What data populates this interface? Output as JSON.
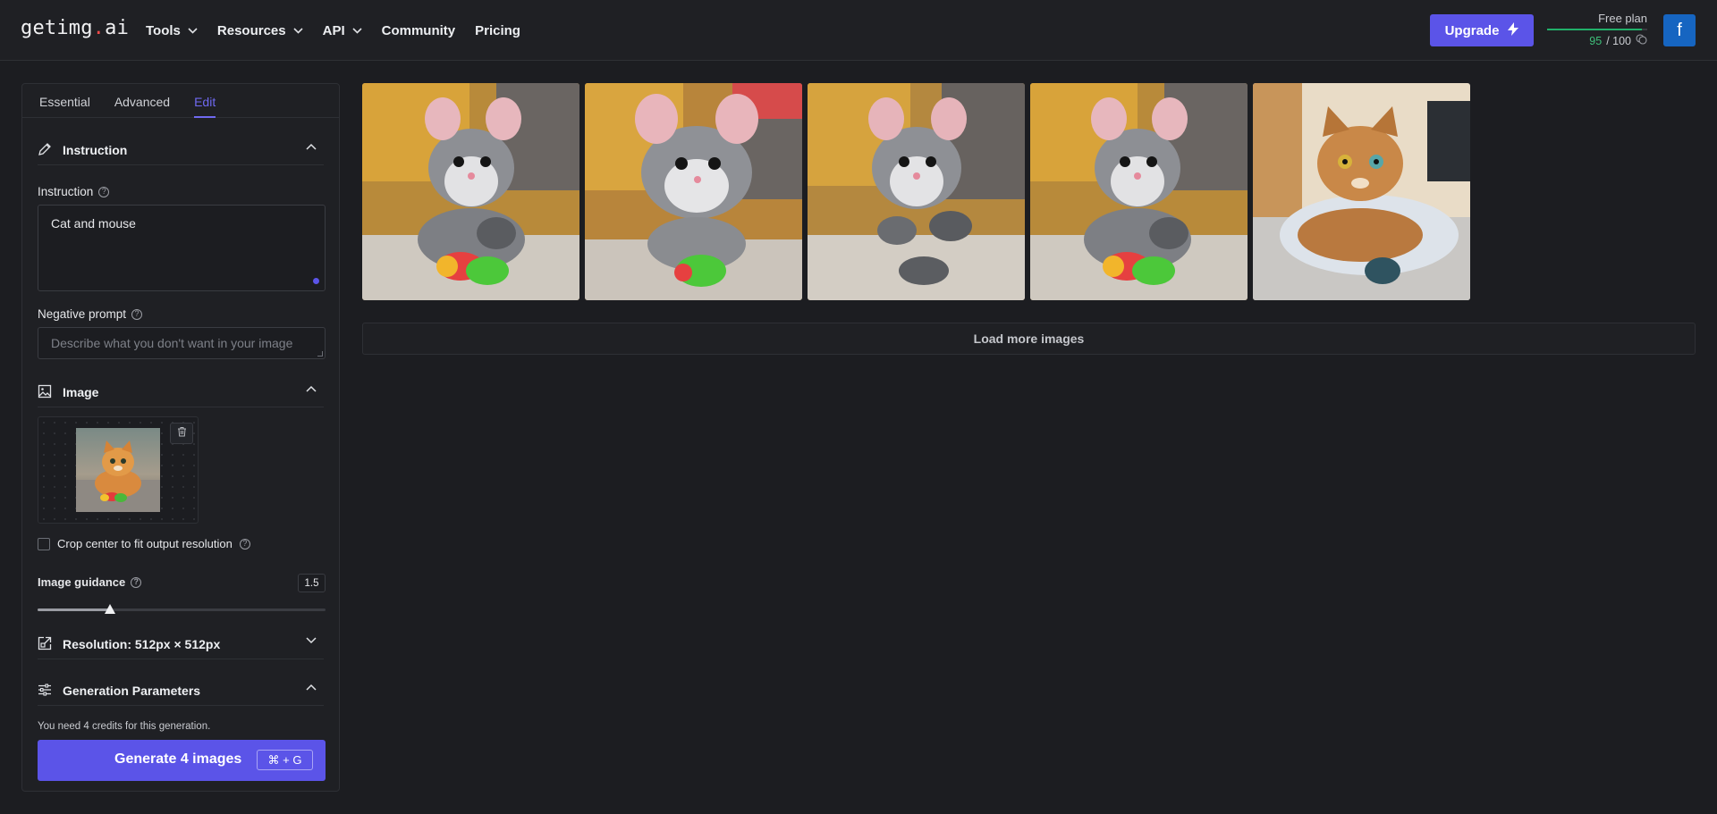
{
  "brand": {
    "logo_pre": "getimg",
    "logo_dot": ".",
    "logo_post": "ai"
  },
  "nav": {
    "items": [
      {
        "label": "Tools",
        "dropdown": true
      },
      {
        "label": "Resources",
        "dropdown": true
      },
      {
        "label": "API",
        "dropdown": true
      },
      {
        "label": "Community",
        "dropdown": false
      },
      {
        "label": "Pricing",
        "dropdown": false
      }
    ]
  },
  "header": {
    "upgrade_label": "Upgrade",
    "plan_label": "Free plan",
    "credits_used": "95",
    "credits_total": "/ 100",
    "credits_fraction": 0.95,
    "avatar_letter": "f"
  },
  "tabs": [
    {
      "label": "Essential",
      "active": false
    },
    {
      "label": "Advanced",
      "active": false
    },
    {
      "label": "Edit",
      "active": true
    }
  ],
  "instruction_section": {
    "title": "Instruction",
    "field_label": "Instruction",
    "value": "Cat and mouse",
    "negative_label": "Negative prompt",
    "negative_placeholder": "Describe what you don't want in your image"
  },
  "image_section": {
    "title": "Image",
    "crop_label": "Crop center to fit output resolution",
    "crop_checked": false,
    "guidance_label": "Image guidance",
    "guidance_value": "1.5",
    "guidance_fraction": 0.25
  },
  "resolution_section": {
    "title": "Resolution: 512px × 512px"
  },
  "params_section": {
    "title": "Generation Parameters"
  },
  "footer": {
    "credits_note": "You need 4 credits for this generation.",
    "generate_label": "Generate 4 images",
    "shortcut": "⌘ + G"
  },
  "gallery": {
    "load_more_label": "Load more images",
    "images": [
      "mouse-photo-1",
      "mouse-photo-2",
      "mouse-photo-3",
      "mouse-photo-4",
      "cat-illustration"
    ]
  },
  "colors": {
    "accent": "#5b54e8",
    "tab_active": "#6f69f0",
    "background": "#1c1d21",
    "credit_bar": "#21b06a"
  }
}
